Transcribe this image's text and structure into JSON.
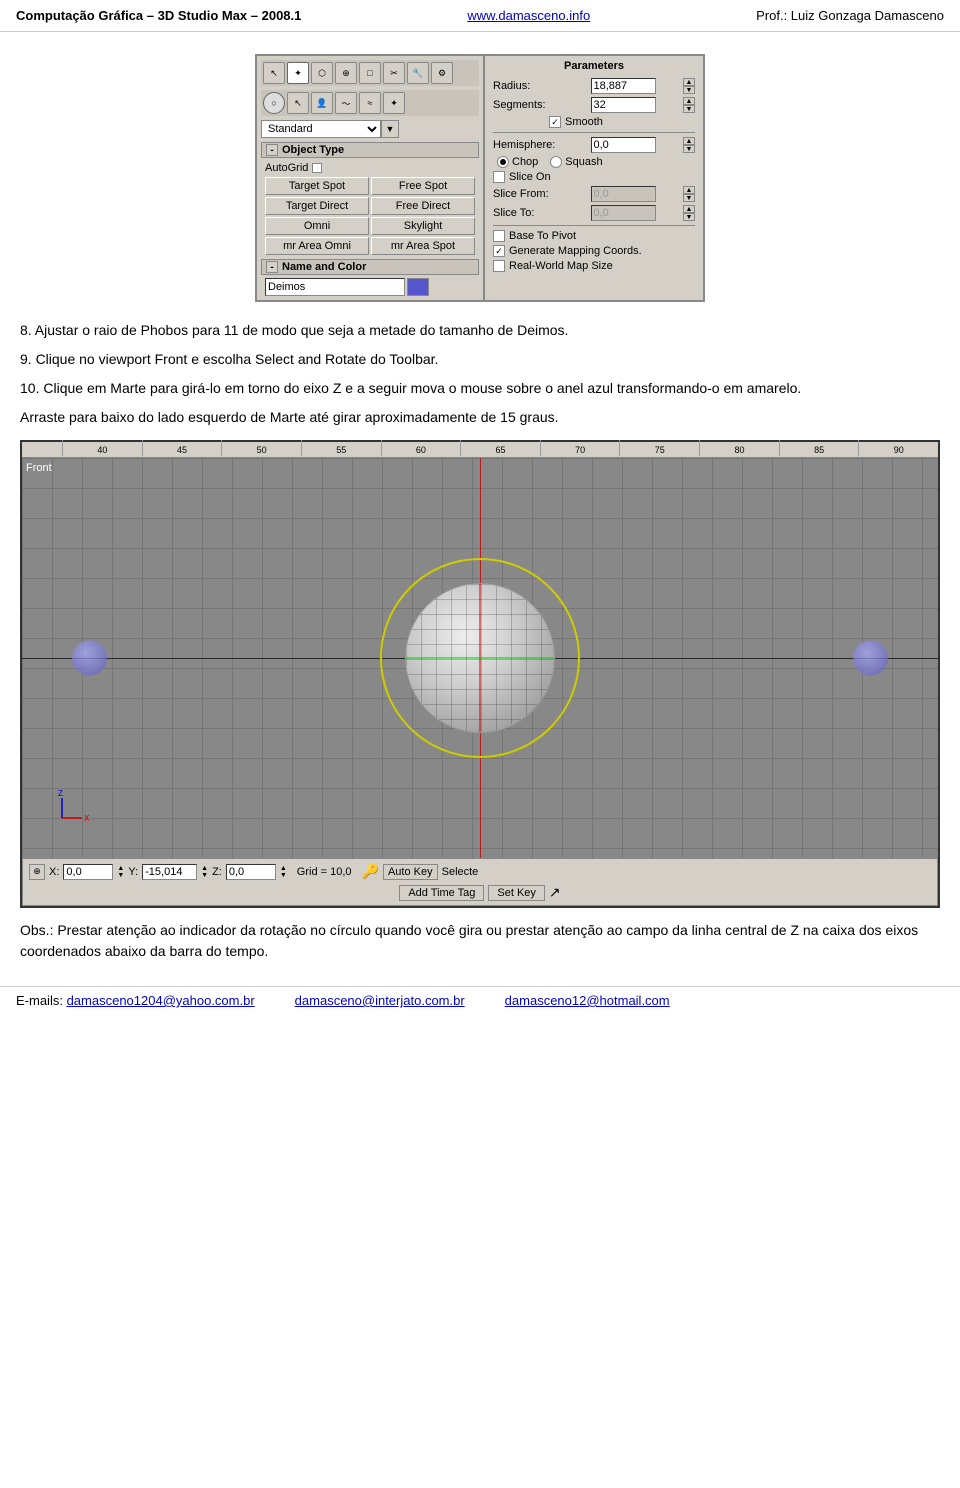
{
  "header": {
    "title": "Computação Gráfica – 3D Studio Max – 2008.1",
    "link_text": "www.damasceno.info",
    "link_url": "http://www.damasceno.info",
    "author": "Prof.: Luiz Gonzaga Damasceno"
  },
  "left_panel": {
    "dropdown_value": "Standard",
    "object_type_header": "Object Type",
    "autogrid_label": "AutoGrid",
    "buttons": [
      {
        "label": "Target Spot",
        "col": 1
      },
      {
        "label": "Free Spot",
        "col": 2
      },
      {
        "label": "Target Direct",
        "col": 1
      },
      {
        "label": "Free Direct",
        "col": 2
      },
      {
        "label": "Omni",
        "col": 1
      },
      {
        "label": "Skylight",
        "col": 2
      },
      {
        "label": "mr Area Omni",
        "col": 1
      },
      {
        "label": "mr Area Spot",
        "col": 2
      }
    ],
    "name_color_header": "Name and Color",
    "name_value": "Deimos"
  },
  "right_panel": {
    "title": "Parameters",
    "radius_label": "Radius:",
    "radius_value": "18,887",
    "segments_label": "Segments:",
    "segments_value": "32",
    "smooth_label": "Smooth",
    "smooth_checked": true,
    "hemisphere_label": "Hemisphere:",
    "hemisphere_value": "0,0",
    "chop_label": "Chop",
    "squash_label": "Squash",
    "slice_on_label": "Slice On",
    "slice_from_label": "Slice From:",
    "slice_from_value": "0,0",
    "slice_to_label": "Slice To:",
    "slice_to_value": "0,0",
    "base_to_pivot_label": "Base To Pivot",
    "generate_mapping_label": "Generate Mapping Coords.",
    "generate_mapping_checked": true,
    "real_world_label": "Real-World Map Size"
  },
  "body": {
    "step8": "8. Ajustar o raio de Phobos para 11 de modo que seja a metade do tamanho de Deimos.",
    "step9": "9. Clique no viewport Front e escolha Select and Rotate do Toolbar.",
    "step10_label": "10.",
    "step10_text": "Clique em Marte para girá-lo em torno do eixo Z e a seguir mova o mouse sobre o anel azul transformando-o em amarelo.",
    "arraste_text": "Arraste para baixo do lado esquerdo de Marte até girar aproximadamente de 15 graus."
  },
  "viewport": {
    "label": "Front",
    "ruler_marks": [
      "40",
      "45",
      "50",
      "55",
      "60",
      "65",
      "70",
      "75",
      "80",
      "85",
      "90"
    ],
    "x_label": "X:",
    "x_value": "0,0",
    "y_label": "Y:",
    "y_value": "-15,014",
    "z_label": "Z:",
    "z_value": "0,0",
    "grid_label": "Grid = 10,0",
    "autokey_label": "Auto Key",
    "select_label": "Selecte",
    "addtime_label": "Add Time Tag",
    "setkey_label": "Set Key"
  },
  "obs": {
    "text": "Obs.: Prestar atenção ao indicador da rotação no círculo quando você gira ou prestar atenção ao campo da linha central de Z na caixa dos eixos coordenados abaixo da barra do tempo."
  },
  "footer": {
    "email1_label": "E-mails:",
    "email1": "damasceno1204@yahoo.com.br",
    "email2": "damasceno@interjato.com.br",
    "email3": "damasceno12@hotmail.com"
  }
}
